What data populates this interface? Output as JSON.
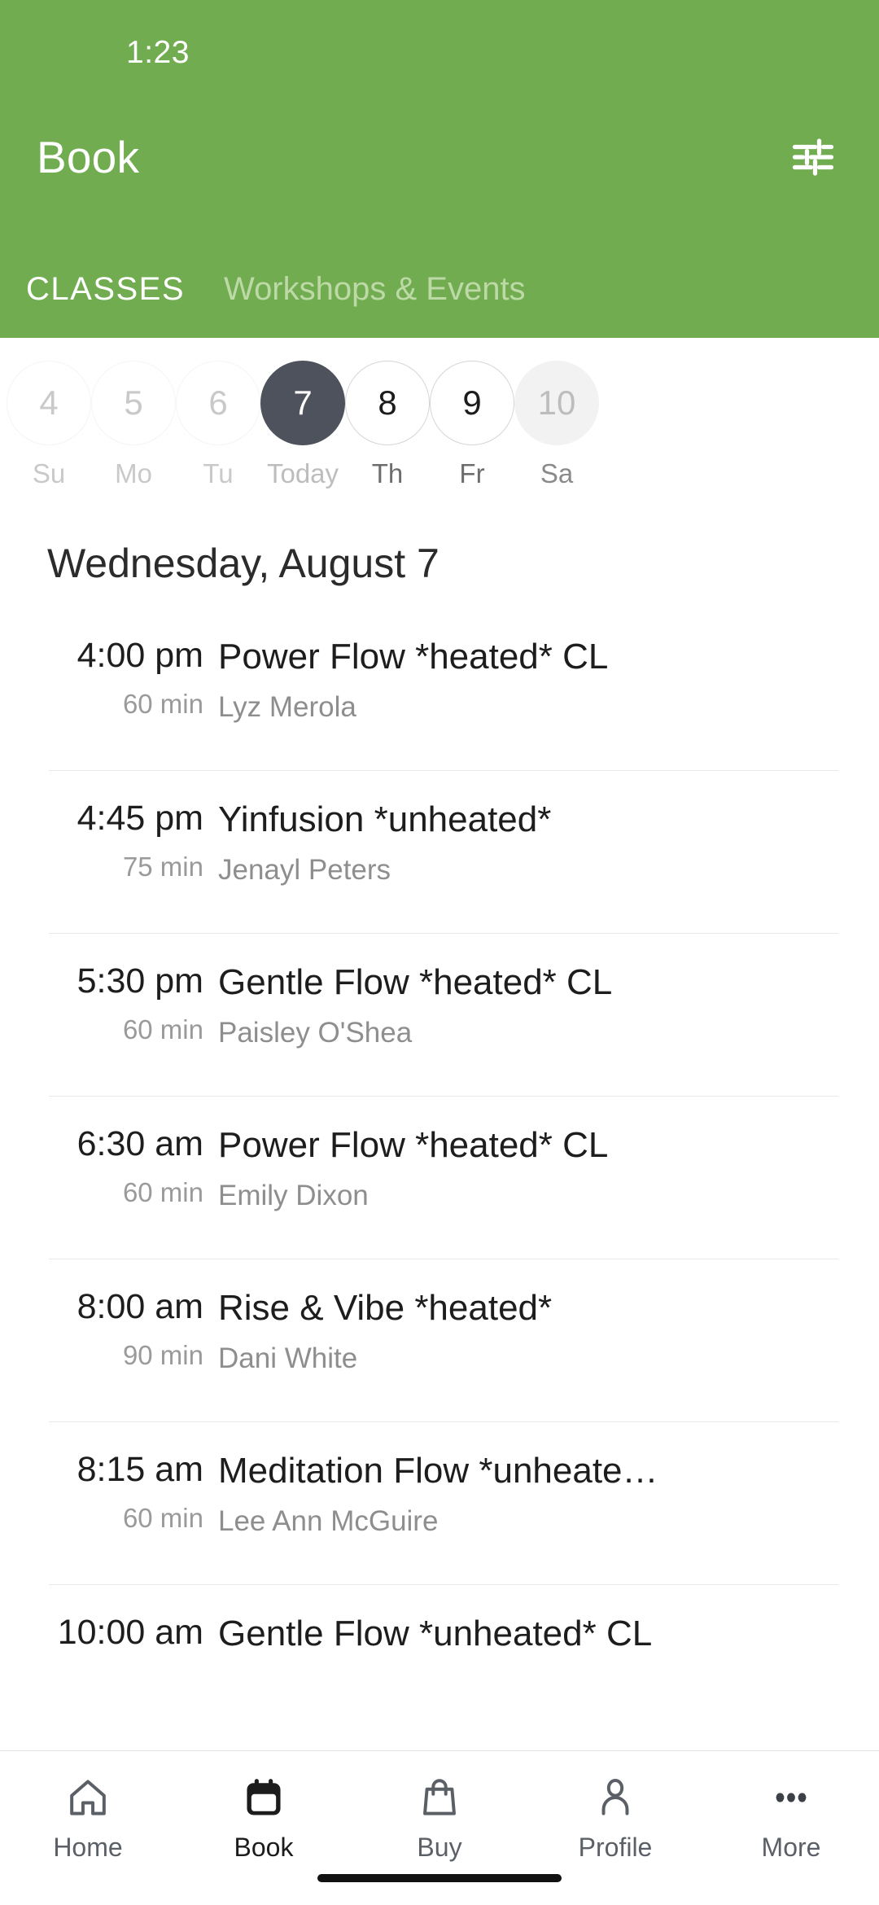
{
  "status_bar": {
    "time": "1:23"
  },
  "header": {
    "title": "Book",
    "filter_icon": "tune-icon",
    "background_color": "#72ac50",
    "tabs": [
      {
        "label": "CLASSES",
        "active": true
      },
      {
        "label": "Workshops & Events",
        "active": false
      }
    ]
  },
  "date_strip": {
    "days": [
      {
        "num": "4",
        "label": "Su",
        "state": "past"
      },
      {
        "num": "5",
        "label": "Mo",
        "state": "past"
      },
      {
        "num": "6",
        "label": "Tu",
        "state": "past"
      },
      {
        "num": "7",
        "label": "Today",
        "state": "today"
      },
      {
        "num": "8",
        "label": "Th",
        "state": "future"
      },
      {
        "num": "9",
        "label": "Fr",
        "state": "future"
      },
      {
        "num": "10",
        "label": "Sa",
        "state": "filled"
      }
    ],
    "selected_color": "#4e525c"
  },
  "day_heading": "Wednesday, August 7",
  "classes": [
    {
      "time": "4:00 pm",
      "duration": "60 min",
      "name": "Power Flow *heated* CL",
      "teacher": "Lyz Merola"
    },
    {
      "time": "4:45 pm",
      "duration": "75 min",
      "name": "Yinfusion *unheated*",
      "teacher": "Jenayl Peters"
    },
    {
      "time": "5:30 pm",
      "duration": "60 min",
      "name": "Gentle Flow *heated* CL",
      "teacher": "Paisley O'Shea"
    },
    {
      "time": "6:30 am",
      "duration": "60 min",
      "name": "Power Flow *heated* CL",
      "teacher": "Emily Dixon"
    },
    {
      "time": "8:00 am",
      "duration": "90 min",
      "name": "Rise & Vibe *heated*",
      "teacher": "Dani White"
    },
    {
      "time": "8:15 am",
      "duration": "60 min",
      "name": "Meditation Flow *unheate…",
      "teacher": "Lee Ann McGuire"
    },
    {
      "time": "10:00 am",
      "duration": "",
      "name": "Gentle Flow *unheated* CL",
      "teacher": ""
    }
  ],
  "bottom_nav": {
    "items": [
      {
        "label": "Home",
        "icon": "home-icon",
        "active": false
      },
      {
        "label": "Book",
        "icon": "calendar-icon",
        "active": true
      },
      {
        "label": "Buy",
        "icon": "bag-icon",
        "active": false
      },
      {
        "label": "Profile",
        "icon": "person-icon",
        "active": false
      },
      {
        "label": "More",
        "icon": "more-dots-icon",
        "active": false
      }
    ]
  }
}
